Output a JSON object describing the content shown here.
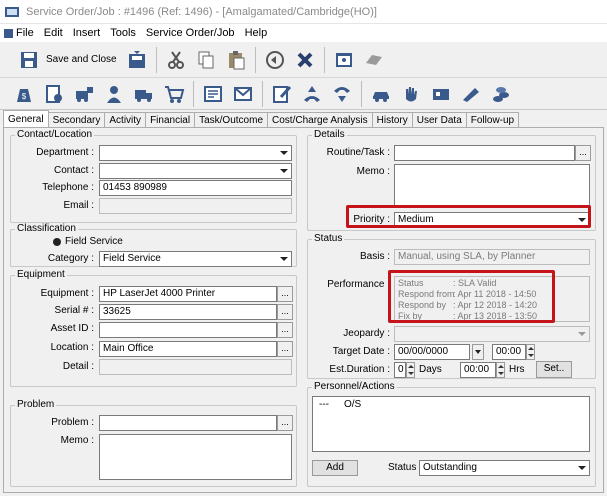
{
  "window": {
    "title": "Service Order/Job : #1496 (Ref: 1496) - [Amalgamated/Cambridge(HO)]"
  },
  "menu": [
    "File",
    "Edit",
    "Insert",
    "Tools",
    "Service Order/Job",
    "Help"
  ],
  "toolbar": {
    "save_close_label": "Save and Close"
  },
  "tabs": [
    "General",
    "Secondary",
    "Activity",
    "Financial",
    "Task/Outcome",
    "Cost/Charge Analysis",
    "History",
    "User Data",
    "Follow-up"
  ],
  "contact": {
    "legend": "Contact/Location",
    "department_label": "Department :",
    "department_value": "",
    "contact_label": "Contact :",
    "contact_value": "",
    "telephone_label": "Telephone :",
    "telephone_value": "01453 890989",
    "email_label": "Email :",
    "email_value": ""
  },
  "classification": {
    "legend": "Classification",
    "radio_label": "Field Service",
    "category_label": "Category :",
    "category_value": "Field Service"
  },
  "equipment": {
    "legend": "Equipment",
    "equipment_label": "Equipment :",
    "equipment_value": "HP LaserJet 4000 Printer",
    "serial_label": "Serial # :",
    "serial_value": "33625",
    "asset_label": "Asset ID :",
    "asset_value": "",
    "location_label": "Location :",
    "location_value": "Main Office",
    "detail_label": "Detail :",
    "detail_value": ""
  },
  "problem": {
    "legend": "Problem",
    "problem_label": "Problem :",
    "problem_value": "",
    "memo_label": "Memo :",
    "memo_value": ""
  },
  "details": {
    "legend": "Details",
    "routine_label": "Routine/Task :",
    "routine_value": "",
    "memo_label": "Memo :",
    "memo_value": "",
    "priority_label": "Priority :",
    "priority_value": "Medium"
  },
  "status": {
    "legend": "Status",
    "basis_label": "Basis :",
    "basis_value": "Manual, using SLA, by Planner",
    "performance_label": "Performance :",
    "performance": [
      {
        "key": "Status",
        "value": ": SLA Valid"
      },
      {
        "key": "Respond from",
        "value": ": Apr 11 2018 - 14:50"
      },
      {
        "key": "Respond by",
        "value": ": Apr 12 2018 - 14:20"
      },
      {
        "key": "Fix by",
        "value": ": Apr 13 2018 - 13:50"
      }
    ],
    "jeopardy_label": "Jeopardy :",
    "jeopardy_value": "",
    "target_date_label": "Target Date :",
    "target_date_value": "00/00/0000",
    "target_time_value": "00:00",
    "duration_label": "Est.Duration :",
    "duration_days": "0",
    "days_label": "Days",
    "duration_hrs": "00:00",
    "hrs_label": "Hrs",
    "set_label": "Set.."
  },
  "personnel": {
    "legend": "Personnel/Actions",
    "rows": [
      {
        "person": "---",
        "action": "O/S"
      }
    ],
    "add_label": "Add",
    "status_label": "Status :",
    "status_value": "Outstanding"
  },
  "colors": {
    "highlight": "#c4141a",
    "toolbar_icon": "#3b5a8c"
  }
}
